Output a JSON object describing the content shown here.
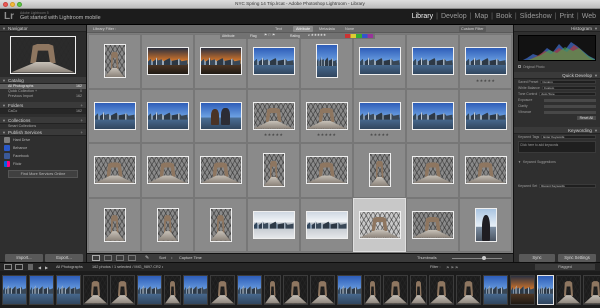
{
  "window": {
    "title": "NYC Spring 14 Trip.lrcat - Adobe Photoshop Lightroom - Library"
  },
  "identity": {
    "sub": "Adobe Lightroom 5",
    "main": "Get started with Lightroom mobile"
  },
  "modules": [
    "Library",
    "Develop",
    "Map",
    "Book",
    "Slideshow",
    "Print",
    "Web"
  ],
  "active_module": "Library",
  "left_panel": {
    "navigator": "Navigator",
    "catalog": "Catalog",
    "catalog_items": [
      {
        "label": "All Photographs",
        "count": "162"
      },
      {
        "label": "Quick Collection +",
        "count": "0"
      },
      {
        "label": "Previous Import",
        "count": "162"
      }
    ],
    "folders": "Folders",
    "folder_items": [
      {
        "label": "CaCo",
        "count": "162"
      }
    ],
    "collections": "Collections",
    "collection_items": [
      {
        "label": "Smart Collections",
        "count": ""
      }
    ],
    "publish": "Publish Services",
    "services": [
      {
        "label": "Hard Drive",
        "color": "#7e7e7e"
      },
      {
        "label": "Behance",
        "color": "#2a59c9"
      },
      {
        "label": "Facebook",
        "color": "#3b5998"
      },
      {
        "label": "Flickr",
        "color": "#ff0084"
      }
    ],
    "find_more": "Find More Services Online",
    "import": "Import...",
    "export": "Export..."
  },
  "filter": {
    "label": "Library Filter :",
    "tabs": [
      "Text",
      "Attribute",
      "Metadata",
      "None"
    ],
    "active": "Attribute",
    "custom": "Custom Filter"
  },
  "grid_attr": {
    "label": "Attribute",
    "rating": "Rating",
    "flag": "Flag"
  },
  "grid": [
    [
      "port:bridge",
      "land:sunset",
      "land:sunset",
      "land:skyline",
      "port:skyline",
      "land:skyline",
      "land:skyline",
      "land:skyline"
    ],
    [
      "land:skyline",
      "land:skyline",
      "land:people",
      "land:bridge",
      "land:bridge",
      "land:skyline",
      "land:skyline",
      "land:skyline"
    ],
    [
      "land:bridge",
      "land:bridge",
      "land:bridge",
      "port:bridge",
      "land:bridge",
      "port:bridge",
      "land:bridge",
      "land:bridge"
    ],
    [
      "port:bridge",
      "port:bridge",
      "port:bridge",
      "land:pale",
      "land:pale",
      "land:bridge",
      "land:bridge",
      "port:person"
    ]
  ],
  "stars_rows": {
    "1": [
      3,
      4,
      5
    ],
    "0": [
      7
    ]
  },
  "selected_cell": "3-5",
  "toolbar": {
    "sort": "Sort",
    "sort_value": "Capture Time",
    "thumbnails": "Thumbnails"
  },
  "right_panel": {
    "histogram": "Histogram",
    "original_photo": "Original Photo",
    "quick_develop": "Quick Develop",
    "saved_preset": "Saved Preset",
    "saved_preset_value": "Custom",
    "white_balance": "White Balance",
    "white_balance_value": "Custom",
    "tone_control": "Tone Control",
    "tone_value": "Auto Tone",
    "exposure": "Exposure",
    "clarity": "Clarity",
    "vibrance": "Vibrance",
    "reset_all": "Reset All",
    "keywording": "Keywording",
    "keyword_tags": "Keyword Tags",
    "keyword_tags_value": "Enter Keywords",
    "keyword_hint": "Click here to add keywords",
    "keyword_suggestions": "Keyword Suggestions",
    "keyword_set": "Keyword Set",
    "keyword_set_value": "Recent Keywords",
    "sync": "Sync",
    "sync_settings": "Sync Settings"
  },
  "filmstrip_bar": {
    "source": "All Photographs",
    "info": "162 photos / 1 selected / IMG_9897.CR2 •",
    "filter": "Filter :",
    "filter_value": "Flagged"
  },
  "filmstrip": [
    "land:skyline",
    "land:skyline",
    "land:skyline",
    "land:bridge",
    "land:bridge",
    "land:skyline",
    "port:bridge",
    "land:skyline",
    "land:bridge",
    "land:skyline",
    "port:bridge",
    "land:bridge",
    "land:bridge",
    "land:skyline",
    "port:bridge",
    "land:bridge",
    "port:bridge",
    "land:bridge",
    "land:bridge",
    "land:skyline",
    "land:sunset",
    "port:skyline",
    "land:bridge",
    "land:bridge"
  ]
}
